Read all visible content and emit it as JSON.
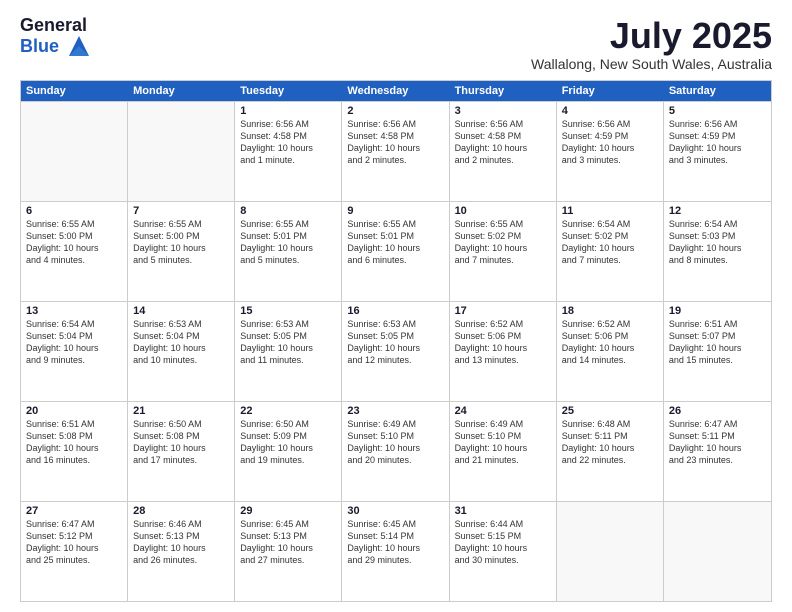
{
  "logo": {
    "general": "General",
    "blue": "Blue"
  },
  "title": {
    "month": "July 2025",
    "location": "Wallalong, New South Wales, Australia"
  },
  "weekdays": [
    "Sunday",
    "Monday",
    "Tuesday",
    "Wednesday",
    "Thursday",
    "Friday",
    "Saturday"
  ],
  "rows": [
    [
      {
        "day": "",
        "lines": []
      },
      {
        "day": "",
        "lines": []
      },
      {
        "day": "1",
        "lines": [
          "Sunrise: 6:56 AM",
          "Sunset: 4:58 PM",
          "Daylight: 10 hours",
          "and 1 minute."
        ]
      },
      {
        "day": "2",
        "lines": [
          "Sunrise: 6:56 AM",
          "Sunset: 4:58 PM",
          "Daylight: 10 hours",
          "and 2 minutes."
        ]
      },
      {
        "day": "3",
        "lines": [
          "Sunrise: 6:56 AM",
          "Sunset: 4:58 PM",
          "Daylight: 10 hours",
          "and 2 minutes."
        ]
      },
      {
        "day": "4",
        "lines": [
          "Sunrise: 6:56 AM",
          "Sunset: 4:59 PM",
          "Daylight: 10 hours",
          "and 3 minutes."
        ]
      },
      {
        "day": "5",
        "lines": [
          "Sunrise: 6:56 AM",
          "Sunset: 4:59 PM",
          "Daylight: 10 hours",
          "and 3 minutes."
        ]
      }
    ],
    [
      {
        "day": "6",
        "lines": [
          "Sunrise: 6:55 AM",
          "Sunset: 5:00 PM",
          "Daylight: 10 hours",
          "and 4 minutes."
        ]
      },
      {
        "day": "7",
        "lines": [
          "Sunrise: 6:55 AM",
          "Sunset: 5:00 PM",
          "Daylight: 10 hours",
          "and 5 minutes."
        ]
      },
      {
        "day": "8",
        "lines": [
          "Sunrise: 6:55 AM",
          "Sunset: 5:01 PM",
          "Daylight: 10 hours",
          "and 5 minutes."
        ]
      },
      {
        "day": "9",
        "lines": [
          "Sunrise: 6:55 AM",
          "Sunset: 5:01 PM",
          "Daylight: 10 hours",
          "and 6 minutes."
        ]
      },
      {
        "day": "10",
        "lines": [
          "Sunrise: 6:55 AM",
          "Sunset: 5:02 PM",
          "Daylight: 10 hours",
          "and 7 minutes."
        ]
      },
      {
        "day": "11",
        "lines": [
          "Sunrise: 6:54 AM",
          "Sunset: 5:02 PM",
          "Daylight: 10 hours",
          "and 7 minutes."
        ]
      },
      {
        "day": "12",
        "lines": [
          "Sunrise: 6:54 AM",
          "Sunset: 5:03 PM",
          "Daylight: 10 hours",
          "and 8 minutes."
        ]
      }
    ],
    [
      {
        "day": "13",
        "lines": [
          "Sunrise: 6:54 AM",
          "Sunset: 5:04 PM",
          "Daylight: 10 hours",
          "and 9 minutes."
        ]
      },
      {
        "day": "14",
        "lines": [
          "Sunrise: 6:53 AM",
          "Sunset: 5:04 PM",
          "Daylight: 10 hours",
          "and 10 minutes."
        ]
      },
      {
        "day": "15",
        "lines": [
          "Sunrise: 6:53 AM",
          "Sunset: 5:05 PM",
          "Daylight: 10 hours",
          "and 11 minutes."
        ]
      },
      {
        "day": "16",
        "lines": [
          "Sunrise: 6:53 AM",
          "Sunset: 5:05 PM",
          "Daylight: 10 hours",
          "and 12 minutes."
        ]
      },
      {
        "day": "17",
        "lines": [
          "Sunrise: 6:52 AM",
          "Sunset: 5:06 PM",
          "Daylight: 10 hours",
          "and 13 minutes."
        ]
      },
      {
        "day": "18",
        "lines": [
          "Sunrise: 6:52 AM",
          "Sunset: 5:06 PM",
          "Daylight: 10 hours",
          "and 14 minutes."
        ]
      },
      {
        "day": "19",
        "lines": [
          "Sunrise: 6:51 AM",
          "Sunset: 5:07 PM",
          "Daylight: 10 hours",
          "and 15 minutes."
        ]
      }
    ],
    [
      {
        "day": "20",
        "lines": [
          "Sunrise: 6:51 AM",
          "Sunset: 5:08 PM",
          "Daylight: 10 hours",
          "and 16 minutes."
        ]
      },
      {
        "day": "21",
        "lines": [
          "Sunrise: 6:50 AM",
          "Sunset: 5:08 PM",
          "Daylight: 10 hours",
          "and 17 minutes."
        ]
      },
      {
        "day": "22",
        "lines": [
          "Sunrise: 6:50 AM",
          "Sunset: 5:09 PM",
          "Daylight: 10 hours",
          "and 19 minutes."
        ]
      },
      {
        "day": "23",
        "lines": [
          "Sunrise: 6:49 AM",
          "Sunset: 5:10 PM",
          "Daylight: 10 hours",
          "and 20 minutes."
        ]
      },
      {
        "day": "24",
        "lines": [
          "Sunrise: 6:49 AM",
          "Sunset: 5:10 PM",
          "Daylight: 10 hours",
          "and 21 minutes."
        ]
      },
      {
        "day": "25",
        "lines": [
          "Sunrise: 6:48 AM",
          "Sunset: 5:11 PM",
          "Daylight: 10 hours",
          "and 22 minutes."
        ]
      },
      {
        "day": "26",
        "lines": [
          "Sunrise: 6:47 AM",
          "Sunset: 5:11 PM",
          "Daylight: 10 hours",
          "and 23 minutes."
        ]
      }
    ],
    [
      {
        "day": "27",
        "lines": [
          "Sunrise: 6:47 AM",
          "Sunset: 5:12 PM",
          "Daylight: 10 hours",
          "and 25 minutes."
        ]
      },
      {
        "day": "28",
        "lines": [
          "Sunrise: 6:46 AM",
          "Sunset: 5:13 PM",
          "Daylight: 10 hours",
          "and 26 minutes."
        ]
      },
      {
        "day": "29",
        "lines": [
          "Sunrise: 6:45 AM",
          "Sunset: 5:13 PM",
          "Daylight: 10 hours",
          "and 27 minutes."
        ]
      },
      {
        "day": "30",
        "lines": [
          "Sunrise: 6:45 AM",
          "Sunset: 5:14 PM",
          "Daylight: 10 hours",
          "and 29 minutes."
        ]
      },
      {
        "day": "31",
        "lines": [
          "Sunrise: 6:44 AM",
          "Sunset: 5:15 PM",
          "Daylight: 10 hours",
          "and 30 minutes."
        ]
      },
      {
        "day": "",
        "lines": []
      },
      {
        "day": "",
        "lines": []
      }
    ]
  ]
}
